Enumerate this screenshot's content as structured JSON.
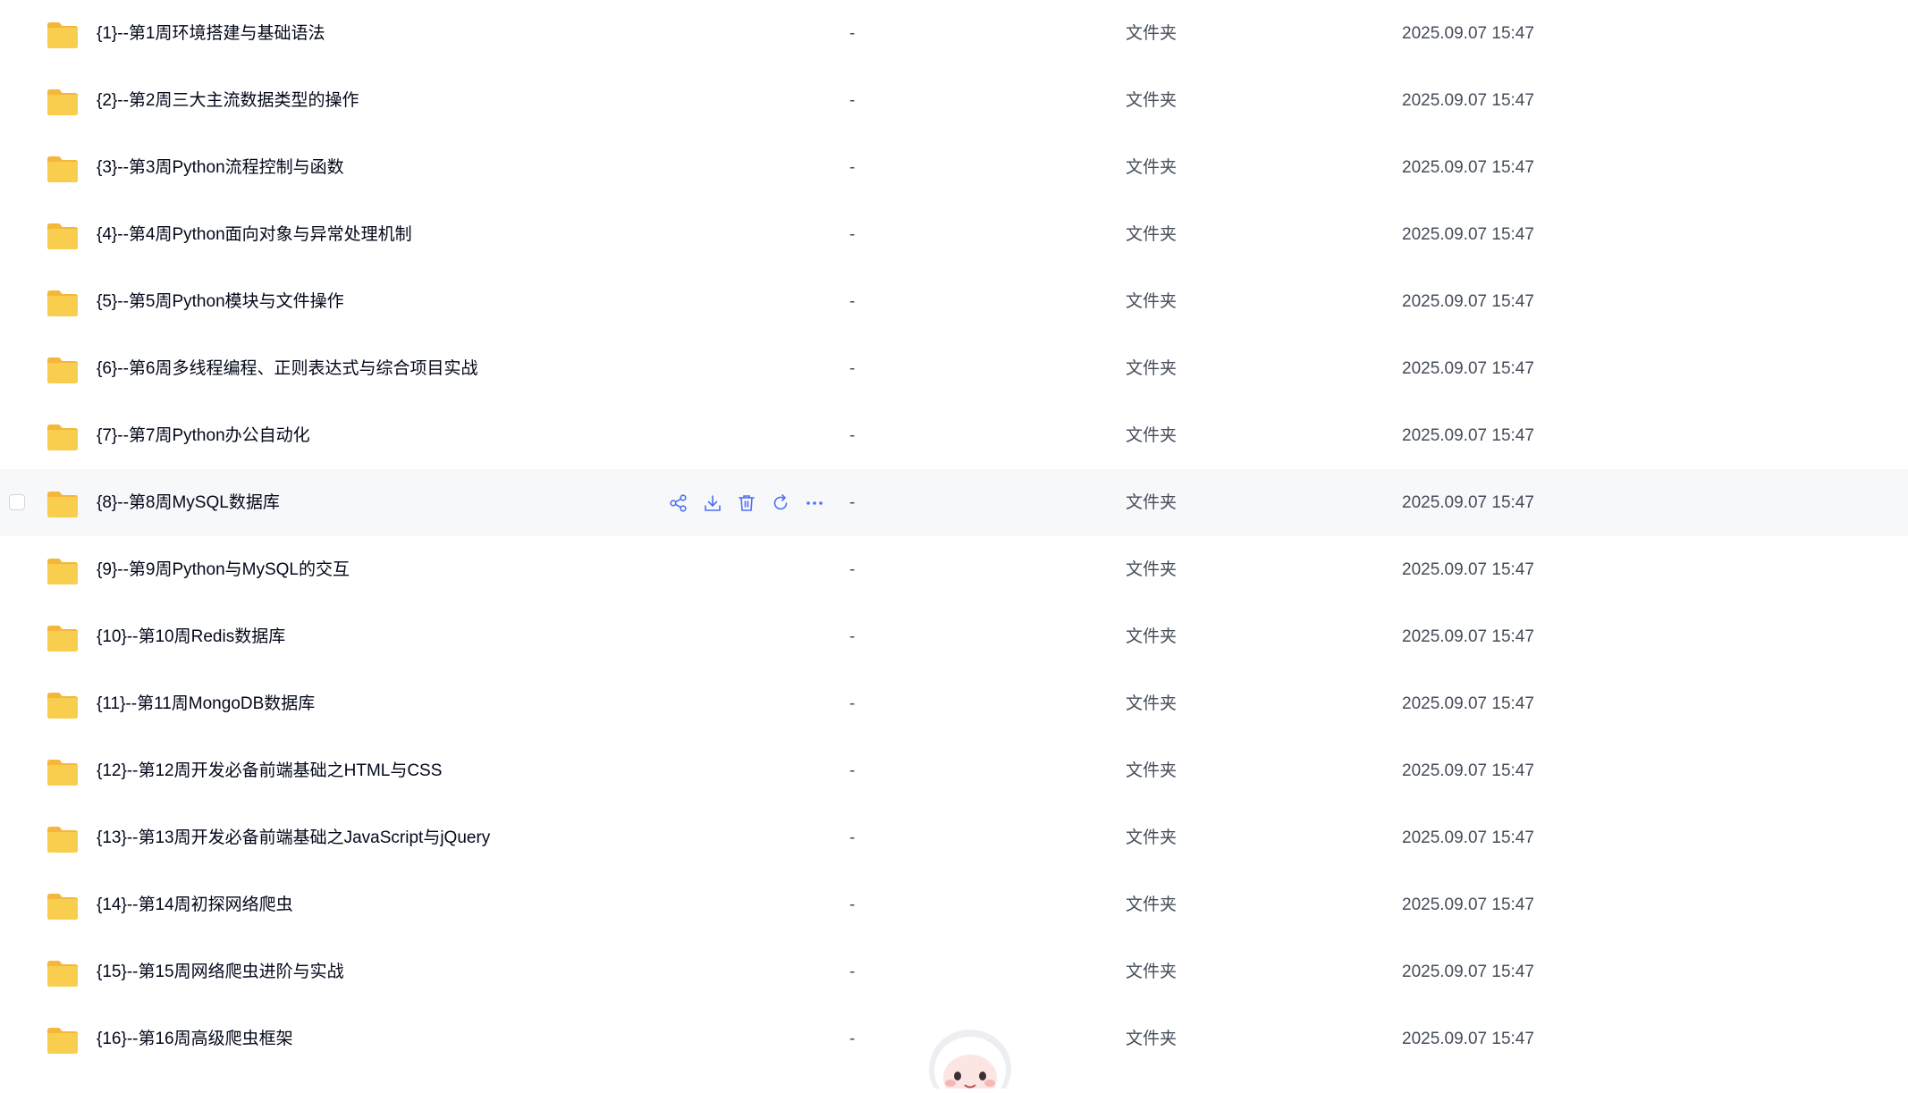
{
  "icons": {
    "folder": "folder-icon",
    "share": "share-icon",
    "download": "download-icon",
    "delete": "trash-icon",
    "refresh": "refresh-icon",
    "more": "more-icon"
  },
  "colors": {
    "accent": "#4e6ef2",
    "folder": "#f9cd4d",
    "folder_shade": "#f4b73a",
    "hover_row": "#f7f8fa"
  },
  "hovered_row_index": 7,
  "files": [
    {
      "name": "{1}--第1周环境搭建与基础语法",
      "size": "-",
      "type": "文件夹",
      "date": "2025.09.07 15:47"
    },
    {
      "name": "{2}--第2周三大主流数据类型的操作",
      "size": "-",
      "type": "文件夹",
      "date": "2025.09.07 15:47"
    },
    {
      "name": "{3}--第3周Python流程控制与函数",
      "size": "-",
      "type": "文件夹",
      "date": "2025.09.07 15:47"
    },
    {
      "name": "{4}--第4周Python面向对象与异常处理机制",
      "size": "-",
      "type": "文件夹",
      "date": "2025.09.07 15:47"
    },
    {
      "name": "{5}--第5周Python模块与文件操作",
      "size": "-",
      "type": "文件夹",
      "date": "2025.09.07 15:47"
    },
    {
      "name": "{6}--第6周多线程编程、正则表达式与综合项目实战",
      "size": "-",
      "type": "文件夹",
      "date": "2025.09.07 15:47"
    },
    {
      "name": "{7}--第7周Python办公自动化",
      "size": "-",
      "type": "文件夹",
      "date": "2025.09.07 15:47"
    },
    {
      "name": "{8}--第8周MySQL数据库",
      "size": "-",
      "type": "文件夹",
      "date": "2025.09.07 15:47"
    },
    {
      "name": "{9}--第9周Python与MySQL的交互",
      "size": "-",
      "type": "文件夹",
      "date": "2025.09.07 15:47"
    },
    {
      "name": "{10}--第10周Redis数据库",
      "size": "-",
      "type": "文件夹",
      "date": "2025.09.07 15:47"
    },
    {
      "name": "{11}--第11周MongoDB数据库",
      "size": "-",
      "type": "文件夹",
      "date": "2025.09.07 15:47"
    },
    {
      "name": "{12}--第12周开发必备前端基础之HTML与CSS",
      "size": "-",
      "type": "文件夹",
      "date": "2025.09.07 15:47"
    },
    {
      "name": "{13}--第13周开发必备前端基础之JavaScript与jQuery",
      "size": "-",
      "type": "文件夹",
      "date": "2025.09.07 15:47"
    },
    {
      "name": "{14}--第14周初探网络爬虫",
      "size": "-",
      "type": "文件夹",
      "date": "2025.09.07 15:47"
    },
    {
      "name": "{15}--第15周网络爬虫进阶与实战",
      "size": "-",
      "type": "文件夹",
      "date": "2025.09.07 15:47"
    },
    {
      "name": "{16}--第16周高级爬虫框架",
      "size": "-",
      "type": "文件夹",
      "date": "2025.09.07 15:47"
    }
  ]
}
